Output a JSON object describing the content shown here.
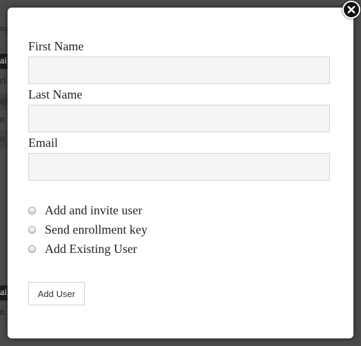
{
  "background": {
    "fragments": [
      "og",
      "ai",
      "ri",
      "@",
      "n",
      "n",
      "ai",
      "n"
    ]
  },
  "form": {
    "first_name_label": "First Name",
    "first_name_value": "",
    "last_name_label": "Last Name",
    "last_name_value": "",
    "email_label": "Email",
    "email_value": "",
    "options": [
      {
        "label": "Add and invite user",
        "selected": false
      },
      {
        "label": "Send enrollment key",
        "selected": false
      },
      {
        "label": "Add Existing User",
        "selected": false
      }
    ],
    "submit_label": "Add User"
  },
  "icons": {
    "close": "close-icon"
  },
  "colors": {
    "overlay": "#3b3b3b",
    "modal_bg": "#ffffff",
    "input_bg": "#f5f5f5",
    "close_bg": "#111111"
  }
}
